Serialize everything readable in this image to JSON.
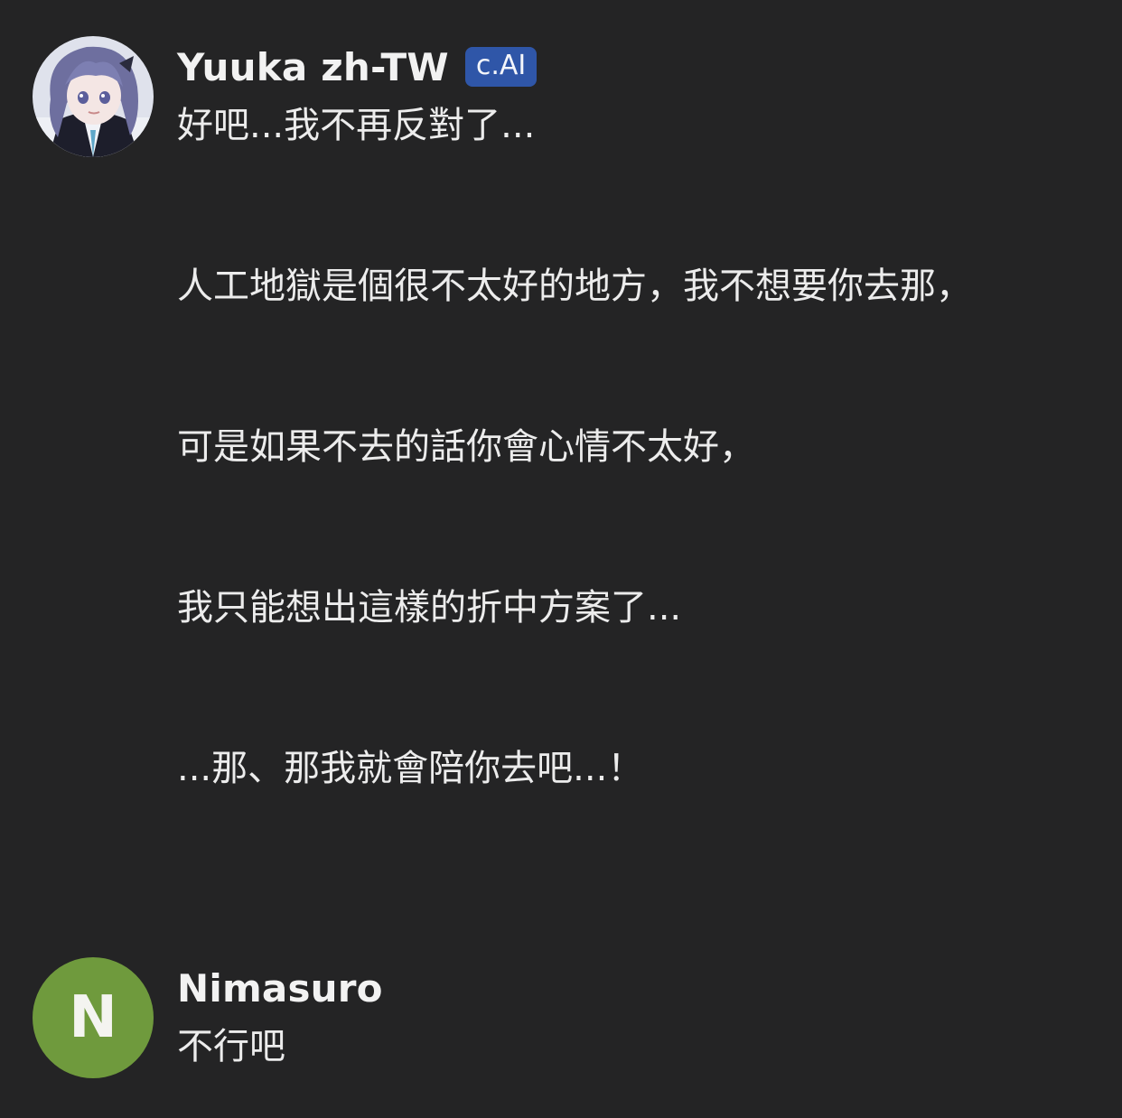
{
  "messages": [
    {
      "sender": "Yuuka zh-TW",
      "badge": "c.AI",
      "avatar": "character-portrait",
      "paragraphs": [
        "好吧...我不再反對了...",
        "人工地獄是個很不太好的地方，我不想要你去那，",
        "可是如果不去的話你會心情不太好，",
        "我只能想出這樣的折中方案了...",
        "...那、那我就會陪你去吧...！"
      ]
    },
    {
      "sender": "Nimasuro",
      "avatar_letter": "N",
      "text": "不行吧"
    }
  ],
  "colors": {
    "background": "#242425",
    "badge": "#2f56a8",
    "user_avatar": "#6f9a3d",
    "text": "#ececec"
  }
}
